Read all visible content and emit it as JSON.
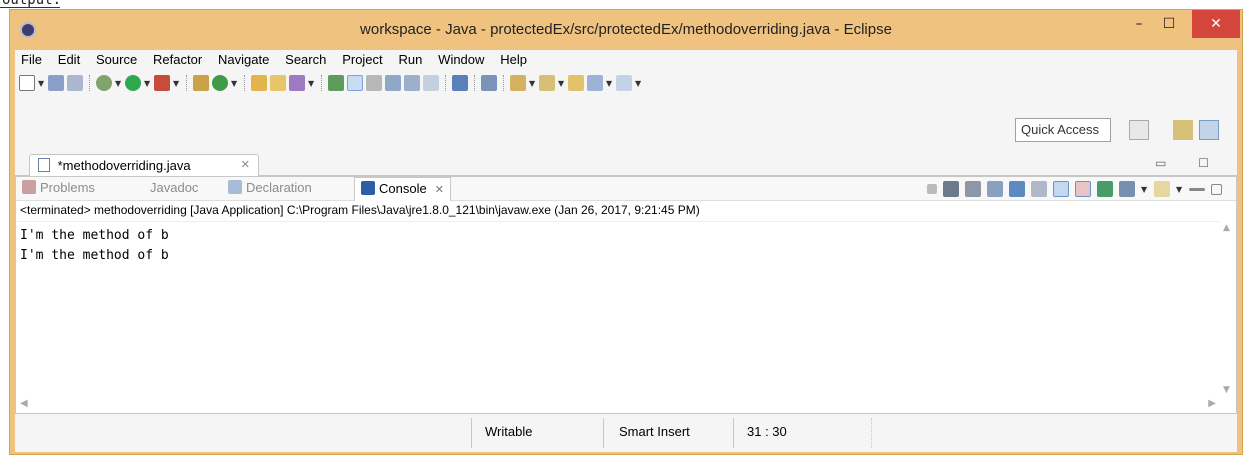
{
  "top_clip": "output:",
  "window": {
    "title": "workspace - Java - protectedEx/src/protectedEx/methodoverriding.java - Eclipse",
    "minimize": "–",
    "maximize": "☐",
    "close": "✕"
  },
  "menu": [
    "File",
    "Edit",
    "Source",
    "Refactor",
    "Navigate",
    "Search",
    "Project",
    "Run",
    "Window",
    "Help"
  ],
  "toolbar2": {
    "quick_access": "Quick Access"
  },
  "editor": {
    "tab_label": "*methodoverriding.java",
    "tab_close": "✕",
    "controls": "▭ ☐"
  },
  "views": {
    "problems": "Problems",
    "javadoc": "Javadoc",
    "declaration": "Declaration",
    "console": "Console",
    "console_close": "✕"
  },
  "console": {
    "terminated": "<terminated> methodoverriding [Java Application] C:\\Program Files\\Java\\jre1.8.0_121\\bin\\javaw.exe (Jan 26, 2017, 9:21:45 PM)",
    "lines": [
      "I'm the method of b",
      "I'm the method of b"
    ]
  },
  "status": {
    "writable": "Writable",
    "insert_mode": "Smart Insert",
    "position": "31 : 30"
  },
  "colors": {
    "title_bar": "#f0c27f",
    "close_button": "#d4463b",
    "chrome": "#f5f5f5"
  }
}
